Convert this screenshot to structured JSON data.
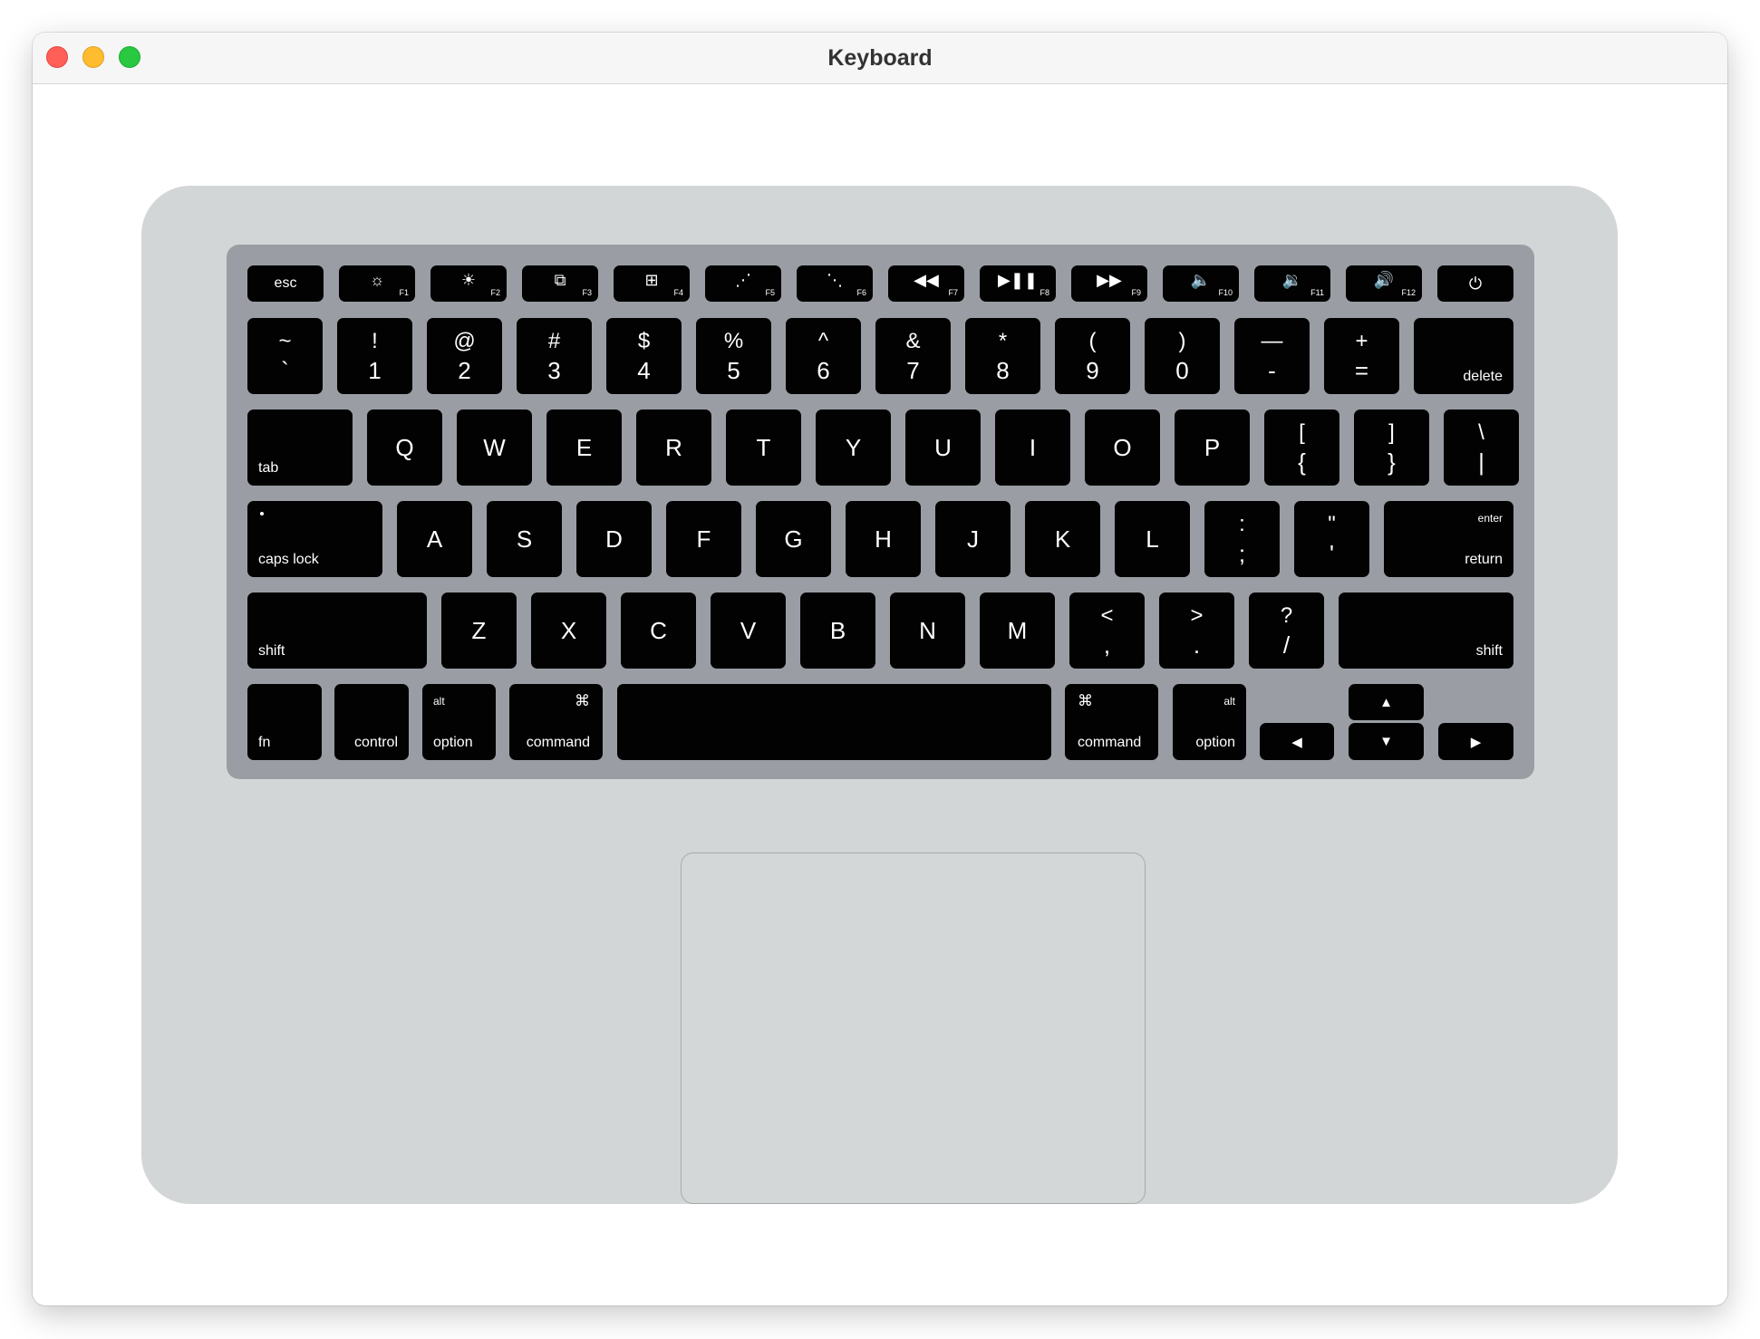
{
  "window": {
    "title": "Keyboard"
  },
  "keyboard": {
    "function_row": {
      "esc": "esc",
      "keys": [
        {
          "fn": "F1",
          "icon": "☼",
          "icon_name": "brightness-down-icon"
        },
        {
          "fn": "F2",
          "icon": "☀",
          "icon_name": "brightness-up-icon"
        },
        {
          "fn": "F3",
          "icon": "⧉",
          "icon_name": "mission-control-icon"
        },
        {
          "fn": "F4",
          "icon": "⊞",
          "icon_name": "launchpad-icon"
        },
        {
          "fn": "F5",
          "icon": "⋰",
          "icon_name": "keyboard-backlight-down-icon"
        },
        {
          "fn": "F6",
          "icon": "⋱",
          "icon_name": "keyboard-backlight-up-icon"
        },
        {
          "fn": "F7",
          "icon": "◀◀",
          "icon_name": "rewind-icon"
        },
        {
          "fn": "F8",
          "icon": "▶❚❚",
          "icon_name": "play-pause-icon"
        },
        {
          "fn": "F9",
          "icon": "▶▶",
          "icon_name": "fast-forward-icon"
        },
        {
          "fn": "F10",
          "icon": "🔈",
          "icon_name": "mute-icon"
        },
        {
          "fn": "F11",
          "icon": "🔉",
          "icon_name": "volume-down-icon"
        },
        {
          "fn": "F12",
          "icon": "🔊",
          "icon_name": "volume-up-icon"
        }
      ],
      "power_icon": "⏻"
    },
    "number_row": {
      "keys": [
        {
          "top": "~",
          "bottom": "`"
        },
        {
          "top": "!",
          "bottom": "1"
        },
        {
          "top": "@",
          "bottom": "2"
        },
        {
          "top": "#",
          "bottom": "3"
        },
        {
          "top": "$",
          "bottom": "4"
        },
        {
          "top": "%",
          "bottom": "5"
        },
        {
          "top": "^",
          "bottom": "6"
        },
        {
          "top": "&",
          "bottom": "7"
        },
        {
          "top": "*",
          "bottom": "8"
        },
        {
          "top": "(",
          "bottom": "9"
        },
        {
          "top": ")",
          "bottom": "0"
        },
        {
          "top": "—",
          "bottom": "-"
        },
        {
          "top": "+",
          "bottom": "="
        }
      ],
      "delete": "delete"
    },
    "qwerty_row": {
      "tab": "tab",
      "letters": [
        "Q",
        "W",
        "E",
        "R",
        "T",
        "Y",
        "U",
        "I",
        "O",
        "P"
      ],
      "symbols": [
        {
          "top": "[",
          "bottom": "{"
        },
        {
          "top": "]",
          "bottom": "}"
        },
        {
          "top": "\\",
          "bottom": "|"
        }
      ]
    },
    "home_row": {
      "caps_lock": "caps lock",
      "letters": [
        "A",
        "S",
        "D",
        "F",
        "G",
        "H",
        "J",
        "K",
        "L"
      ],
      "symbols": [
        {
          "top": ":",
          "bottom": ";"
        },
        {
          "top": "\"",
          "bottom": "'"
        }
      ],
      "enter": "enter",
      "return": "return"
    },
    "shift_row": {
      "shift_left": "shift",
      "letters": [
        "Z",
        "X",
        "C",
        "V",
        "B",
        "N",
        "M"
      ],
      "symbols": [
        {
          "top": "<",
          "bottom": ","
        },
        {
          "top": ">",
          "bottom": "."
        },
        {
          "top": "?",
          "bottom": "/"
        }
      ],
      "shift_right": "shift"
    },
    "bottom_row": {
      "fn": "fn",
      "control": "control",
      "alt": "alt",
      "option": "option",
      "command_symbol": "⌘",
      "command": "command",
      "arrows": {
        "up": "▲",
        "left": "◀",
        "down": "▼",
        "right": "▶"
      }
    }
  }
}
